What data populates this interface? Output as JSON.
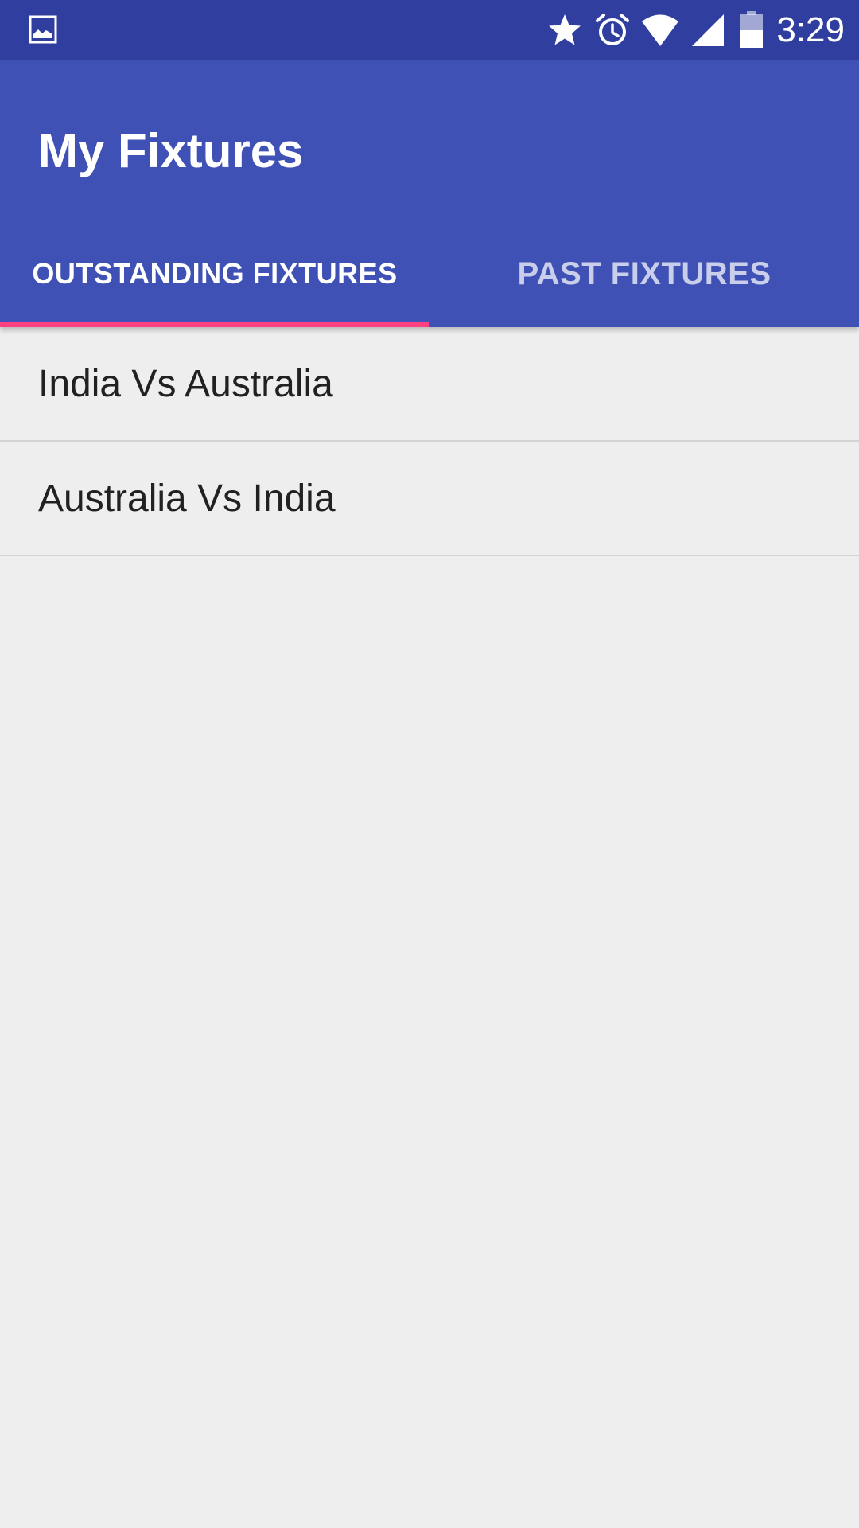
{
  "status_bar": {
    "time": "3:29",
    "left_icon": "image-icon",
    "icons": [
      "star-icon",
      "alarm-icon",
      "wifi-icon",
      "signal-icon",
      "battery-icon"
    ]
  },
  "app_bar": {
    "title": "My Fixtures",
    "color": "#3f51b5",
    "status_color": "#303f9f"
  },
  "tabs": [
    {
      "label": "OUTSTANDING FIXTURES",
      "selected": true
    },
    {
      "label": "PAST FIXTURES",
      "selected": false
    }
  ],
  "tab_indicator_color": "#ff4081",
  "fixtures": [
    {
      "label": "India Vs Australia"
    },
    {
      "label": "Australia Vs India"
    }
  ]
}
